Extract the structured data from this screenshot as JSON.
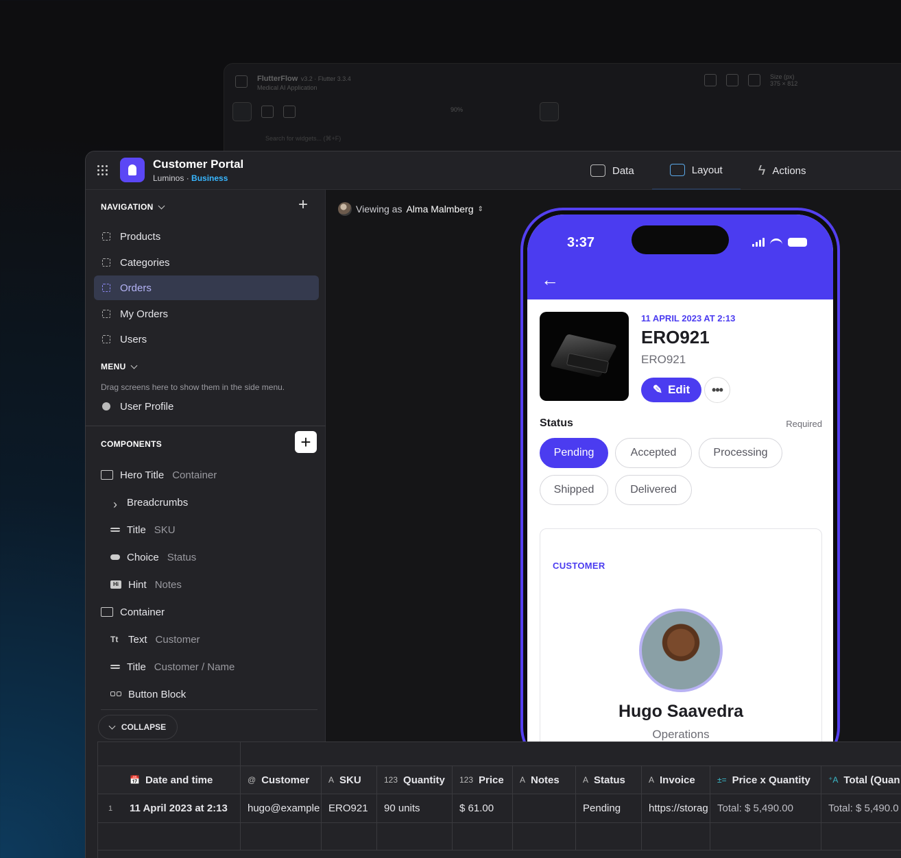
{
  "back_window": {
    "title": "FlutterFlow",
    "version": "v3.2 · Flutter 3.3.4",
    "project": "Medical AI Application",
    "zoom": "90%",
    "size_label": "Size (px)",
    "size_value": "375 × 812",
    "search_placeholder": "Search for widgets... (⌘+F)"
  },
  "header": {
    "app_title": "Customer Portal",
    "org": "Luminos",
    "separator": " · ",
    "plan": "Business",
    "tabs": [
      {
        "label": "Data",
        "icon": "table-icon"
      },
      {
        "label": "Layout",
        "icon": "layout-icon",
        "active": true
      },
      {
        "label": "Actions",
        "icon": "bolt-icon"
      }
    ]
  },
  "sidebar": {
    "navigation_heading": "NAVIGATION",
    "nav_items": [
      {
        "label": "Products"
      },
      {
        "label": "Categories"
      },
      {
        "label": "Orders",
        "active": true
      },
      {
        "label": "My Orders"
      },
      {
        "label": "Users"
      }
    ],
    "menu_heading": "MENU",
    "menu_hint": "Drag screens here to show them in the side menu.",
    "menu_items": [
      {
        "label": "User Profile"
      }
    ],
    "components_heading": "COMPONENTS",
    "components": [
      {
        "name": "Hero Title",
        "type": "Container",
        "icon": "container-icon",
        "level": 1
      },
      {
        "name": "Breadcrumbs",
        "type": "",
        "icon": "chevron-right-icon",
        "level": 2
      },
      {
        "name": "Title",
        "type": "SKU",
        "icon": "title-icon",
        "level": 2
      },
      {
        "name": "Choice",
        "type": "Status",
        "icon": "choice-icon",
        "level": 2
      },
      {
        "name": "Hint",
        "type": "Notes",
        "icon": "hint-icon",
        "level": 2
      },
      {
        "name": "Container",
        "type": "",
        "icon": "container-icon",
        "level": 1
      },
      {
        "name": "Text",
        "type": "Customer",
        "icon": "text-icon",
        "level": 2
      },
      {
        "name": "Title",
        "type": "Customer / Name",
        "icon": "title-icon",
        "level": 2
      },
      {
        "name": "Button Block",
        "type": "",
        "icon": "button-block-icon",
        "level": 2
      }
    ],
    "collapse_label": "COLLAPSE"
  },
  "canvas": {
    "viewing_prefix": "Viewing as",
    "viewing_user": "Alma Malmberg"
  },
  "phone": {
    "time": "3:37",
    "order": {
      "date": "11 APRIL 2023 AT 2:13",
      "title": "ERO921",
      "sku": "ERO921",
      "edit_label": "Edit",
      "more_label": "•••"
    },
    "status": {
      "label": "Status",
      "required": "Required",
      "options": [
        "Pending",
        "Accepted",
        "Processing",
        "Shipped",
        "Delivered"
      ],
      "selected": "Pending"
    },
    "customer": {
      "section_label": "CUSTOMER",
      "name": "Hugo Saavedra",
      "role": "Operations"
    }
  },
  "table": {
    "columns": [
      {
        "label": "Date and time",
        "icon": "📅"
      },
      {
        "label": "Customer",
        "icon": "@"
      },
      {
        "label": "SKU",
        "icon": "A"
      },
      {
        "label": "Quantity",
        "icon": "123"
      },
      {
        "label": "Price",
        "icon": "123"
      },
      {
        "label": "Notes",
        "icon": "A"
      },
      {
        "label": "Status",
        "icon": "A"
      },
      {
        "label": "Invoice",
        "icon": "A"
      },
      {
        "label": "Price x Quantity",
        "icon": "±="
      },
      {
        "label": "Total (Quan",
        "icon": "⁺A"
      }
    ],
    "rows": [
      {
        "index": "1",
        "cells": [
          "11 April 2023 at 2:13",
          "hugo@example",
          "ERO921",
          "90 units",
          "$ 61.00",
          "",
          "Pending",
          "https://storag",
          "Total: $ 5,490.00",
          "Total: $ 5,490.0"
        ]
      }
    ]
  },
  "colors": {
    "accent": "#4b3cf0",
    "plan": "#38b6ff",
    "sidebar_active_bg": "#353a4e"
  }
}
